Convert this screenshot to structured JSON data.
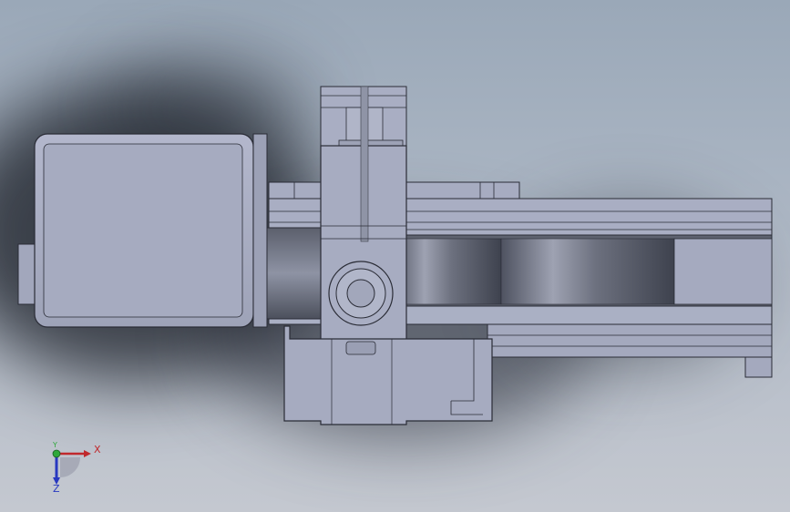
{
  "viewport": {
    "background_top": "#9aa8b8",
    "background_bottom": "#c4c8d0",
    "model_fill": "#a8adc2",
    "model_fill_dark": "#8d92a8",
    "edge_color": "#2a2c36"
  },
  "triad": {
    "x_label": "X",
    "y_label": "Y",
    "z_label": "Z",
    "x_color": "#c0282c",
    "y_color": "#2fa83a",
    "z_color": "#2838c0"
  }
}
